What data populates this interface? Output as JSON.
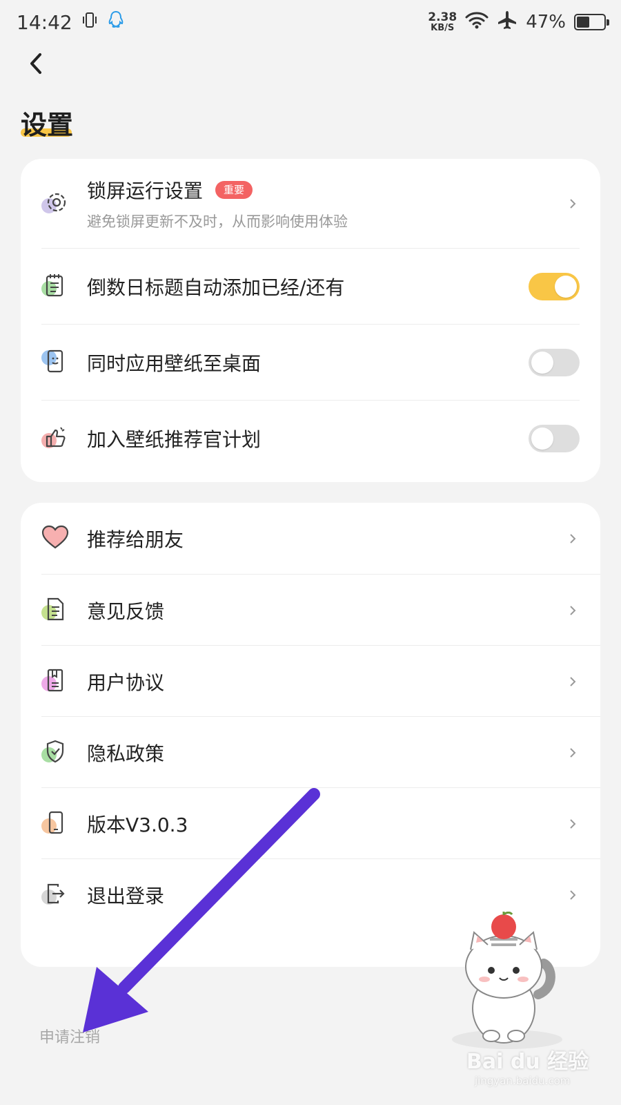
{
  "status_bar": {
    "time": "14:42",
    "net_speed_value": "2.38",
    "net_speed_unit": "KB/S",
    "battery": "47%",
    "battery_level": 0.47
  },
  "header": {
    "back_icon": "chevron-left-icon",
    "title": "设置"
  },
  "settings_card": {
    "items": [
      {
        "label": "锁屏运行设置",
        "badge": "重要",
        "subtitle": "避免锁屏更新不及时，从而影响使用体验",
        "icon": "gear-icon",
        "color": "#b4a9d8"
      },
      {
        "label": "倒数日标题自动添加已经/还有",
        "toggle": true,
        "icon": "notepad-icon",
        "color": "#8fd18a"
      },
      {
        "label": "同时应用壁纸至桌面",
        "toggle": false,
        "icon": "phone-face-icon",
        "color": "#7fb0ec"
      },
      {
        "label": "加入壁纸推荐官计划",
        "toggle": false,
        "icon": "thumb-up-icon",
        "color": "#f29a9a"
      }
    ]
  },
  "menu_card": {
    "items": [
      {
        "label": "推荐给朋友",
        "icon": "heart-icon",
        "color": "#f4a1a1"
      },
      {
        "label": "意见反馈",
        "icon": "feedback-doc-icon",
        "color": "#b6d97a"
      },
      {
        "label": "用户协议",
        "icon": "agreement-doc-icon",
        "color": "#e79ae0"
      },
      {
        "label": "隐私政策",
        "icon": "shield-check-icon",
        "color": "#8fd18a"
      },
      {
        "label": "版本V3.0.3",
        "icon": "phone-icon",
        "color": "#f4b98c"
      },
      {
        "label": "退出登录",
        "icon": "logout-icon",
        "color": "#c9c9c9"
      }
    ]
  },
  "footer": {
    "cancel_account": "申请注销"
  },
  "watermark": {
    "brand": "Bai du 经验",
    "url": "jingyan.baidu.com"
  },
  "colors": {
    "accent": "#f9c646",
    "badge": "#f36363",
    "annotation_arrow": "#5a31d6"
  }
}
